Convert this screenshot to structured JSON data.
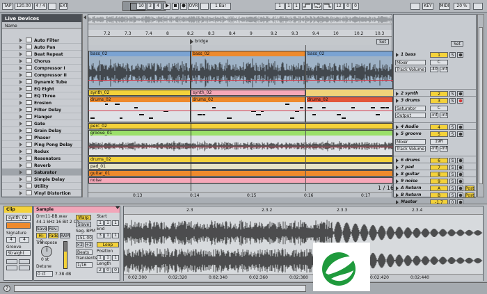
{
  "transport": {
    "tap": "TAP",
    "tempo": "120.00",
    "sig": "4 / 4",
    "pos_bar": "10",
    "pos_beat": "3",
    "pos_sixteenth": "4",
    "ext": "EXT",
    "ovr": "OVR",
    "quant": "1 Bar",
    "loop_start_bar": "1",
    "loop_start_beat": "1",
    "loop_start_six": "1",
    "loop_len_bar": "12",
    "loop_len_beat": "0",
    "loop_len_six": "0",
    "key": "KEY",
    "midi": "MIDI",
    "cpu": "20 %",
    "set_label": "Set",
    "d_label": "D"
  },
  "browser": {
    "title": "Live Devices",
    "column": "Name",
    "items": [
      "Auto Filter",
      "Auto Pan",
      "Beat Repeat",
      "Chorus",
      "Compressor I",
      "Compressor II",
      "Dynamic Tube",
      "EQ Eight",
      "EQ Three",
      "Erosion",
      "Filter Delay",
      "Flanger",
      "Gate",
      "Grain Delay",
      "Phaser",
      "Ping Pong Delay",
      "Redux",
      "Resonators",
      "Reverb",
      "Saturator",
      "Simple Delay",
      "Utility",
      "Vinyl Distortion"
    ],
    "selected": "Saturator"
  },
  "arrangement": {
    "ruler": [
      "7.2",
      "7.3",
      "7.4",
      "8",
      "8.2",
      "8.3",
      "8.4",
      "9",
      "9.2",
      "9.3",
      "9.4",
      "10",
      "10.2",
      "10.3",
      "10.4",
      "11"
    ],
    "locator": "bridge",
    "set_label": "Set",
    "clip_labels": {
      "bass_a": "bass_02",
      "bass_b": "bass_02",
      "bass_c": "bass_02",
      "synth_a": "synth_02",
      "synth_b": "synth_02",
      "drums_a": "drums_02",
      "drums_b": "drums_02",
      "drums_c": "drums_02",
      "perc": "perc_02",
      "groove": "groove_01",
      "drums2": "drums_02",
      "pad": "pad_01",
      "guitar": "guitar_01",
      "noise": "noise"
    },
    "time": [
      "0:13",
      "0:14",
      "0:15",
      "0:16",
      "0:17"
    ],
    "zoom": "1 / 16"
  },
  "mixer": {
    "tracks": [
      {
        "name": "1 bass",
        "num": "1",
        "s": "S",
        "dev": "Mixer",
        "dev2": "C",
        "chain": "Track Volume",
        "val1": "-40",
        "val2": "-inf"
      },
      {
        "name": "2 synth",
        "num": "2",
        "s": "S"
      },
      {
        "name": "3 drums",
        "num": "3",
        "s": "S",
        "dev": "Saturator",
        "dev2": "C",
        "chain": "Output",
        "val1": "-inf",
        "val2": "-inf"
      },
      {
        "name": "4 Audio",
        "num": "4",
        "s": "S"
      },
      {
        "name": "5 groove",
        "num": "5",
        "s": "S",
        "dev": "Mixer",
        "dev2": "19R",
        "chain": "Track Volume",
        "val1": "-inf",
        "val2": "-inf"
      },
      {
        "name": "6 drums",
        "num": "6",
        "s": "S"
      },
      {
        "name": "7 pad",
        "num": "7",
        "s": "S"
      },
      {
        "name": "8 guitar",
        "num": "8",
        "s": "S"
      },
      {
        "name": "9 noise",
        "num": "9",
        "s": "S"
      },
      {
        "name": "A Return",
        "num": "A",
        "s": "S",
        "post": "Post"
      },
      {
        "name": "B Return",
        "num": "B",
        "s": "S",
        "post": "Post"
      },
      {
        "name": "Master",
        "num": "-1.7",
        "s": "0"
      }
    ]
  },
  "clip_view": {
    "clip_title": "Clip",
    "clip_name": "synth_02",
    "signature_label": "Signature",
    "sig_num": "4",
    "sig_den": "4",
    "groove_label": "Groove",
    "groove_val": "Straight",
    "sample_title": "Sample",
    "file": "Drm11-BB.wav",
    "info": "44.1 kHz 16 Bit 2 Ch",
    "save": "Save",
    "rev": "Rev.",
    "hiq": "Hi-Q",
    "fade": "Fade",
    "ram": "RAM",
    "transpose_label": "Transpose",
    "transpose_val": "0 st",
    "detune_label": "Detune",
    "detune_val": "0 ct",
    "gain_val": "7.38 dB",
    "warp": "Warp",
    "slave": "Slave",
    "segbpm_label": "Seg. BPM",
    "segbpm": "151.00",
    "double": "×2",
    "half": "÷2",
    "beats": "Beats",
    "transients_label": "Transients",
    "transients": "1/16",
    "start_label": "Start",
    "end_label": "End",
    "loop": "Loop",
    "position_label": "Position",
    "length_label": "Length",
    "start_vals": [
      "1",
      "1",
      "1"
    ],
    "end_vals": [
      "3",
      "1",
      "1"
    ],
    "pos_vals": [
      "1",
      "1",
      "1"
    ],
    "len_vals": [
      "2",
      "0",
      "0"
    ],
    "bars": [
      "2.3",
      "2.3.2",
      "2.3.3",
      "2.3.4"
    ],
    "times": [
      "0:02:300",
      "0:02:320",
      "0:02:340",
      "0:02:360",
      "0:02:380",
      "0:02:400",
      "0:02:420",
      "0:02:440"
    ]
  },
  "colors": {
    "accent": "#f4d23a",
    "orange": "#ee8a2c",
    "pink": "#f2a6b9",
    "green": "#9be06a",
    "logo": "#1f9a3c"
  }
}
